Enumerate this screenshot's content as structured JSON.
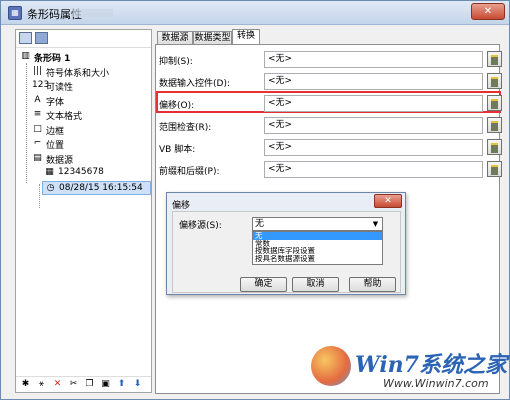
{
  "window": {
    "title": "条形码属性",
    "close_glyph": "✕"
  },
  "tree": [
    {
      "label": "条形码 1",
      "icon": "barcode-icon",
      "glyph": "▥",
      "depth": 0
    },
    {
      "label": "符号体系和大小",
      "icon": "symbology-icon",
      "glyph": "|||",
      "depth": 1
    },
    {
      "label": "可读性",
      "icon": "readability-icon",
      "glyph": "123",
      "depth": 1
    },
    {
      "label": "字体",
      "icon": "font-icon",
      "glyph": "A",
      "depth": 1
    },
    {
      "label": "文本格式",
      "icon": "text-format-icon",
      "glyph": "≡",
      "depth": 1
    },
    {
      "label": "边框",
      "icon": "border-icon",
      "glyph": "□",
      "depth": 1
    },
    {
      "label": "位置",
      "icon": "position-icon",
      "glyph": "⌐",
      "depth": 1
    },
    {
      "label": "数据源",
      "icon": "datasource-icon",
      "glyph": "▤",
      "depth": 1
    },
    {
      "label": "12345678",
      "icon": "data-icon",
      "glyph": "▦",
      "depth": 2
    },
    {
      "label": "08/28/15 16:15:54",
      "icon": "clock-icon",
      "glyph": "◷",
      "depth": 2,
      "selected": true
    }
  ],
  "bottom_toolbar": [
    {
      "name": "new-item-icon",
      "glyph": "✱"
    },
    {
      "name": "wand-icon",
      "glyph": "⚹"
    },
    {
      "name": "delete-icon",
      "glyph": "✕"
    },
    {
      "name": "cut-icon",
      "glyph": "✂"
    },
    {
      "name": "copy-icon",
      "glyph": "❐"
    },
    {
      "name": "paste-icon",
      "glyph": "▣"
    },
    {
      "name": "move-up-icon",
      "glyph": "⬆"
    },
    {
      "name": "move-down-icon",
      "glyph": "⬇"
    }
  ],
  "tabs": [
    {
      "label": "数据源",
      "active": false
    },
    {
      "label": "数据类型",
      "active": false
    },
    {
      "label": "转换",
      "active": true
    }
  ],
  "properties": [
    {
      "label": "抑制(S):",
      "value": "<无>"
    },
    {
      "label": "数据输入控件(D):",
      "value": "<无>"
    },
    {
      "label": "偏移(O):",
      "value": "<无>"
    },
    {
      "label": "范围检查(R):",
      "value": "<无>"
    },
    {
      "label": "VB 脚本:",
      "value": "<无>"
    },
    {
      "label": "前缀和后缀(P):",
      "value": "<无>"
    }
  ],
  "dialog": {
    "title": "偏移",
    "close_glyph": "✕",
    "field_label": "偏移源(S):",
    "selected": "无",
    "arrow": "▼",
    "options": [
      "无",
      "常数",
      "按数据库字段设置",
      "按具名数据源设置"
    ],
    "buttons": {
      "ok": "确定",
      "cancel": "取消",
      "help": "帮助"
    }
  },
  "watermark": {
    "brand": "Win7系统之家",
    "url": "Www.Winwin7.com"
  },
  "colors": {
    "highlight": "#e53131",
    "selection": "#3399ff"
  }
}
